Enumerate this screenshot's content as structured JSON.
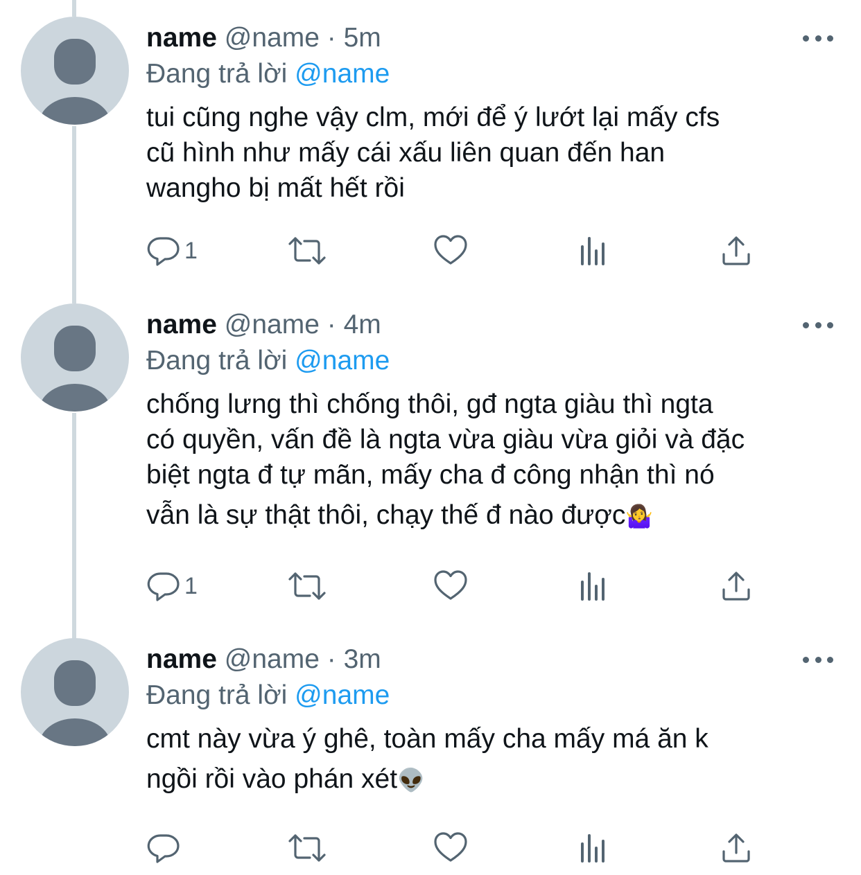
{
  "tweets": [
    {
      "name": "name",
      "handle": "@name",
      "sep": " · ",
      "time": "5m",
      "reply_prefix": "Đang trả lời ",
      "reply_handle": "@name",
      "lines": [
        "tui cũng nghe vậy clm, mới để ý lướt lại mấy cfs",
        "cũ hình như mấy cái xấu liên quan đến han",
        "wangho bị mất hết rồi"
      ],
      "reply_count": "1"
    },
    {
      "name": "name",
      "handle": "@name",
      "sep": " · ",
      "time": "4m",
      "reply_prefix": "Đang trả lời ",
      "reply_handle": "@name",
      "lines": [
        "chống lưng thì chống thôi, gđ ngta giàu thì ngta",
        "có quyền, vấn đề là ngta vừa giàu vừa giỏi và đặc",
        "biệt ngta đ tự mãn, mấy cha đ công nhận thì nó",
        "vẫn là sự thật thôi, chạy thế đ nào được"
      ],
      "emoji": "🤷‍♀️",
      "reply_count": "1"
    },
    {
      "name": "name",
      "handle": "@name",
      "sep": " · ",
      "time": "3m",
      "reply_prefix": "Đang trả lời ",
      "reply_handle": "@name",
      "lines": [
        "cmt này vừa ý ghê, toàn mấy cha mấy má ăn k",
        "ngồi rồi vào phán xét"
      ],
      "emoji": "👽",
      "reply_count": ""
    }
  ],
  "icons": [
    "avatar-placeholder-icon",
    "more-icon",
    "reply-icon",
    "retweet-icon",
    "like-icon",
    "views-icon",
    "share-icon"
  ],
  "colors": {
    "text": "#0f1419",
    "secondary": "#536471",
    "link": "#1d9bf0",
    "avatar_bg": "#ccd6dd",
    "avatar_fg": "#687684",
    "thread_line": "#cfd9de"
  }
}
